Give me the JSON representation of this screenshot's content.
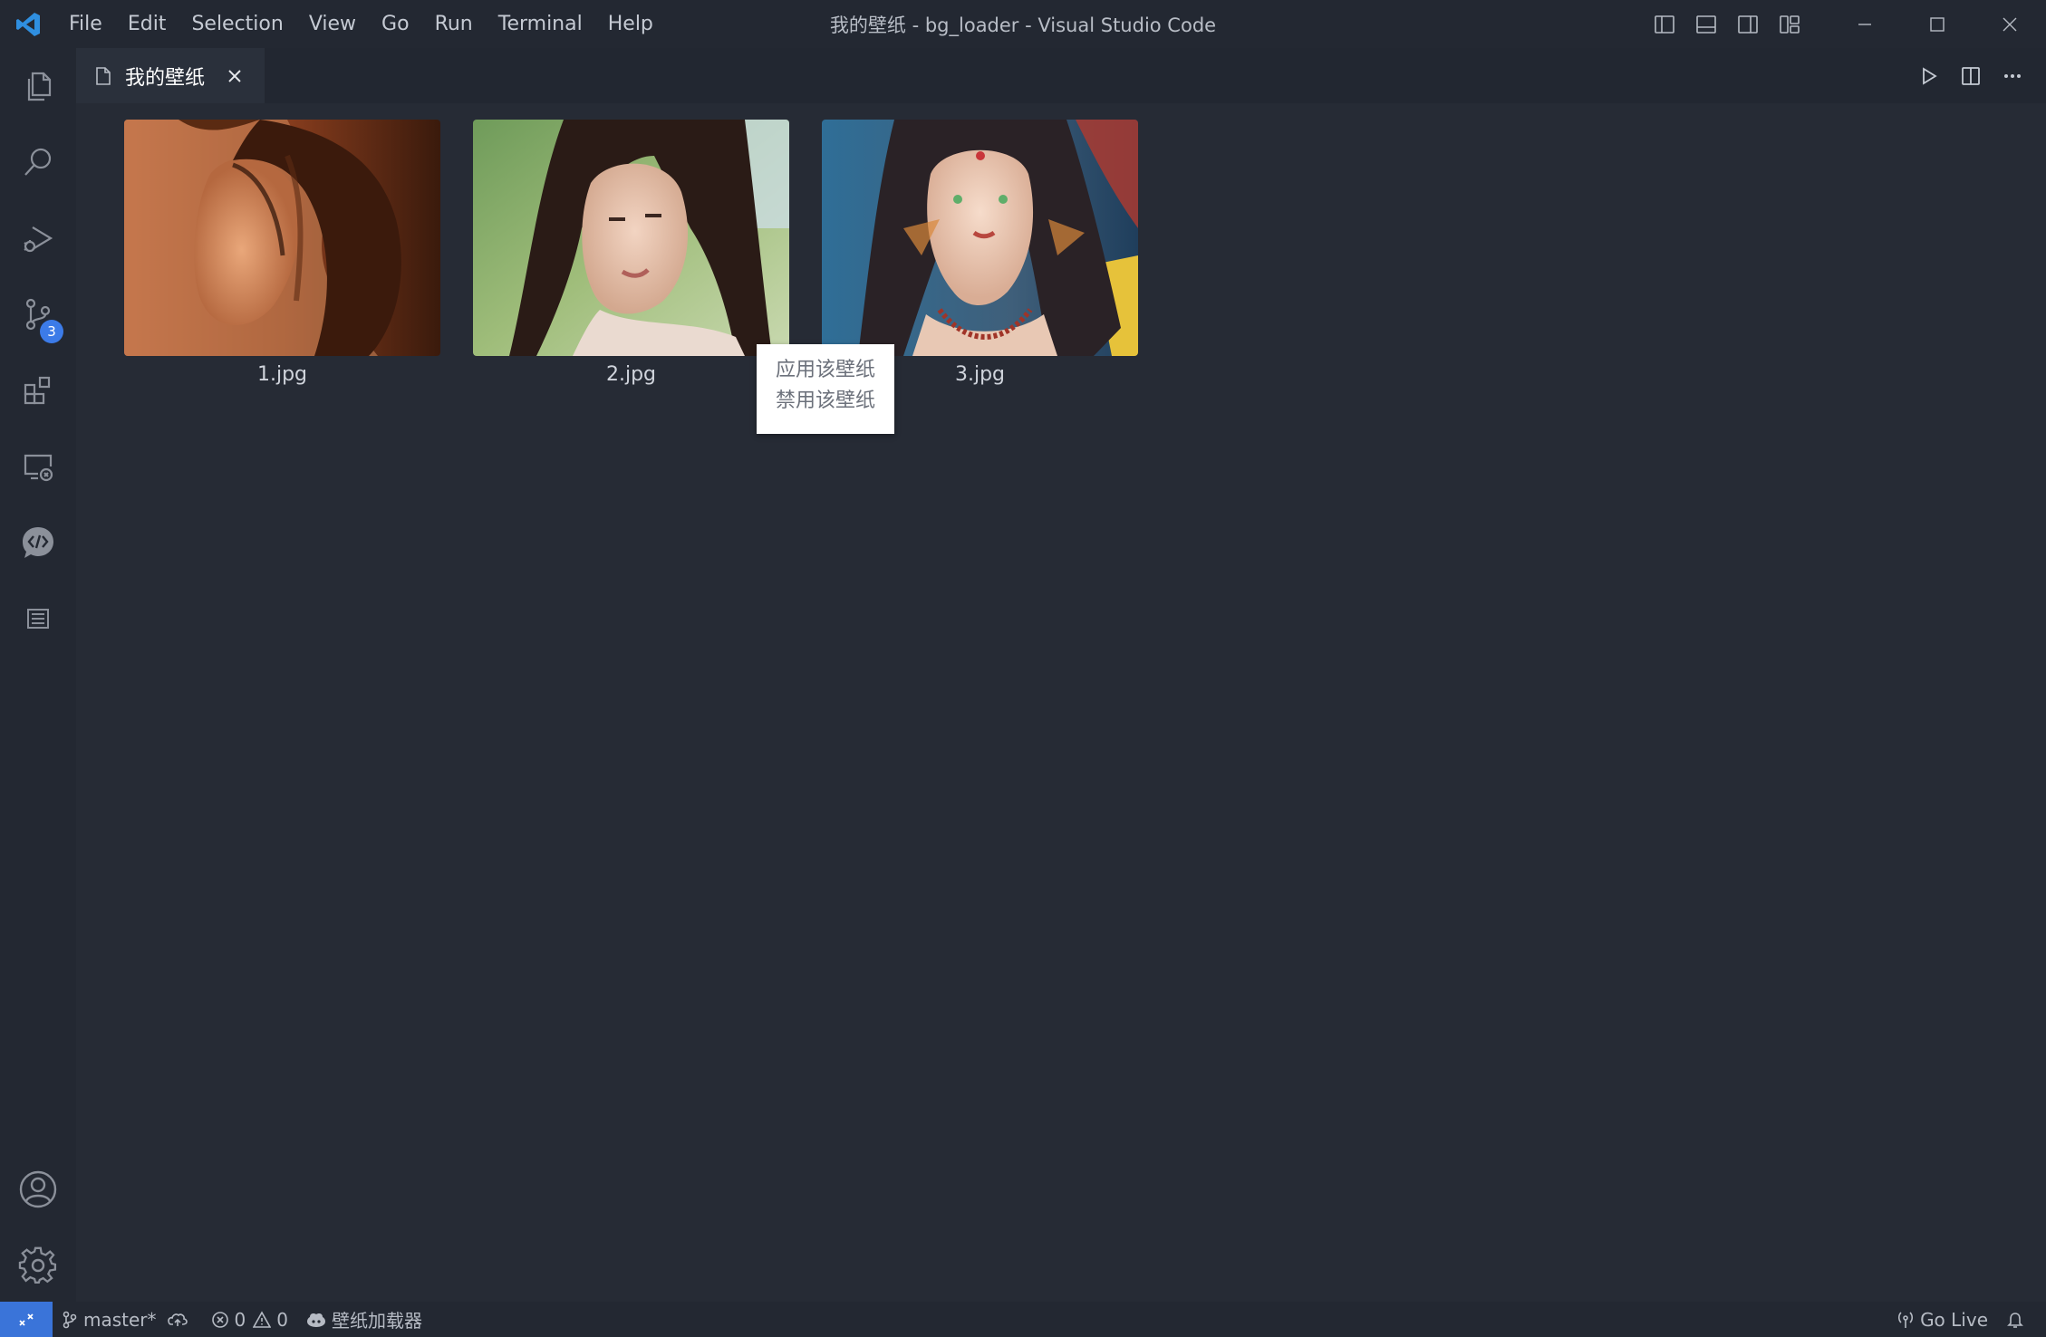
{
  "window": {
    "title": "我的壁纸 - bg_loader - Visual Studio Code"
  },
  "menu": [
    "File",
    "Edit",
    "Selection",
    "View",
    "Go",
    "Run",
    "Terminal",
    "Help"
  ],
  "activity": {
    "source_control_badge": "3"
  },
  "tab": {
    "label": "我的壁纸"
  },
  "gallery": {
    "images": [
      {
        "caption": "1.jpg"
      },
      {
        "caption": "2.jpg"
      },
      {
        "caption": "3.jpg"
      }
    ]
  },
  "context_menu": {
    "items": [
      "应用该壁纸",
      "禁用该壁纸"
    ]
  },
  "status": {
    "branch": "master*",
    "errors": "0",
    "warnings": "0",
    "extension": "壁纸加载器",
    "go_live": "Go Live"
  },
  "colors": {
    "accent": "#3a74d9",
    "badge": "#3c7be8",
    "background": "#262b35",
    "chrome": "#232832"
  }
}
